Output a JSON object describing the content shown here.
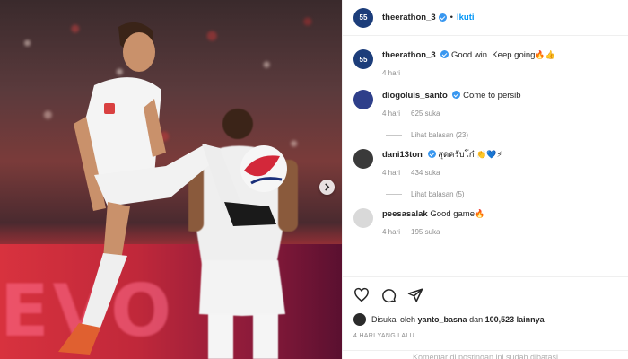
{
  "post": {
    "author": "theerathon_3",
    "follow_label": "Ikuti",
    "separator": "•"
  },
  "comments": [
    {
      "user": "theerathon_3",
      "text": "Good win. Keep going",
      "emoji": "🔥👍",
      "time": "4 hari",
      "likes": "",
      "replies": ""
    },
    {
      "user": "diogoluis_santo",
      "text": "Come to persib",
      "emoji": "",
      "time": "4 hari",
      "likes": "625 suka",
      "replies": "Lihat balasan (23)"
    },
    {
      "user": "dani13ton",
      "text": "สุดครับโก๋",
      "emoji": "👏💙⚡",
      "time": "4 hari",
      "likes": "434 suka",
      "replies": "Lihat balasan (5)"
    },
    {
      "user": "peesasalak",
      "text": "Good game",
      "emoji": "🔥",
      "time": "4 hari",
      "likes": "195 suka",
      "replies": ""
    }
  ],
  "likes": {
    "prefix": "Disukai oleh",
    "user": "yanto_basna",
    "suffix": "dan",
    "count": "100,523 lainnya"
  },
  "date_label": "4 HARI YANG LALU",
  "comments_disabled": "Komentar di postingan ini sudah dibatasi",
  "icons": [
    "heart-icon",
    "comment-icon",
    "share-icon",
    "chevron-right-icon",
    "verified-icon"
  ],
  "colors": {
    "accent": "#0095f6",
    "verified": "#3897f0",
    "muted": "#8e8e8e"
  },
  "media": {
    "banner_text": "EVO"
  }
}
